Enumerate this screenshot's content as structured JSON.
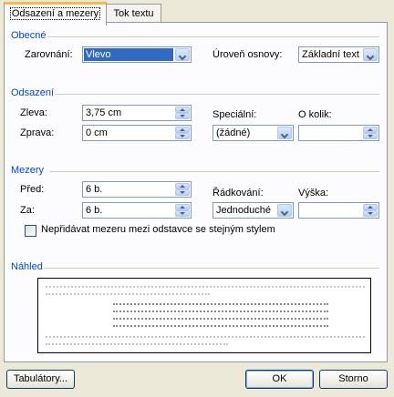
{
  "tabs": [
    {
      "label": "Odsazení a mezery",
      "active": true
    },
    {
      "label": "Tok textu",
      "active": false
    }
  ],
  "general": {
    "title": "Obecné",
    "alignment_label": "Zarovnání:",
    "alignment_value": "Vlevo",
    "outline_label": "Úroveň osnovy:",
    "outline_value": "Základní text"
  },
  "indentation": {
    "title": "Odsazení",
    "left_label": "Zleva:",
    "left_value": "3,75 cm",
    "right_label": "Zprava:",
    "right_value": "0 cm",
    "special_label": "Speciální:",
    "special_value": "(žádné)",
    "by_label": "O kolik:",
    "by_value": ""
  },
  "spacing": {
    "title": "Mezery",
    "before_label": "Před:",
    "before_value": "6 b.",
    "after_label": "Za:",
    "after_value": "6 b.",
    "line_label": "Řádkování:",
    "line_value": "Jednoduché",
    "at_label": "Výška:",
    "at_value": "",
    "no_space_label": "Nepřidávat mezeru mezi odstavce se stejným stylem",
    "no_space_checked": false
  },
  "preview": {
    "title": "Náhled"
  },
  "footer": {
    "tabs_button": "Tabulátory...",
    "ok_button": "OK",
    "cancel_button": "Storno"
  },
  "colors": {
    "dialog_bg": "#ece9d8",
    "group_title": "#0046d5",
    "selection": "#316ac5",
    "active_tab_accent": "#f7b94a"
  }
}
